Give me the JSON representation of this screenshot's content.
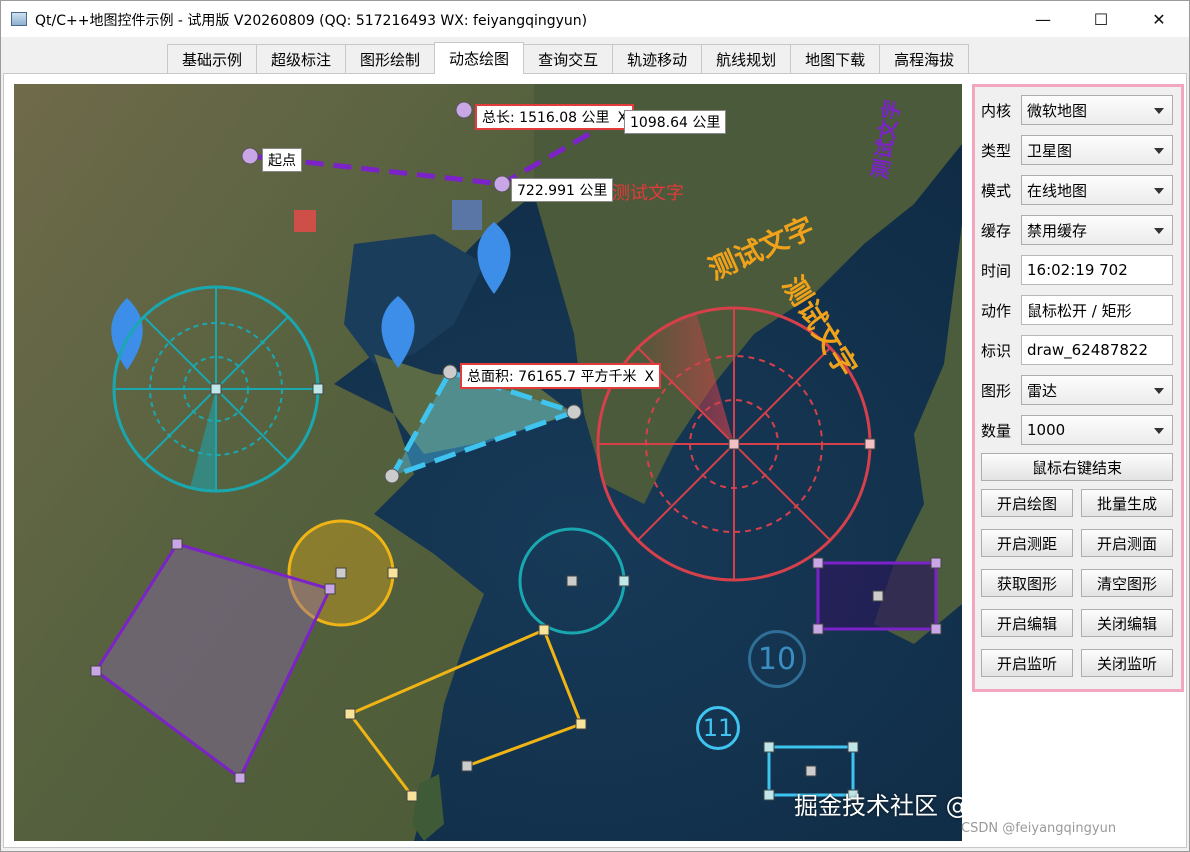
{
  "window": {
    "title": "Qt/C++地图控件示例 - 试用版 V20260809 (QQ: 517216493 WX: feiyangqingyun)",
    "minimize": "—",
    "maximize": "☐",
    "close": "✕"
  },
  "tabs": [
    {
      "label": "基础示例",
      "active": false
    },
    {
      "label": "超级标注",
      "active": false
    },
    {
      "label": "图形绘制",
      "active": false
    },
    {
      "label": "动态绘图",
      "active": true
    },
    {
      "label": "查询交互",
      "active": false
    },
    {
      "label": "轨迹移动",
      "active": false
    },
    {
      "label": "航线规划",
      "active": false
    },
    {
      "label": "地图下载",
      "active": false
    },
    {
      "label": "高程海拔",
      "active": false
    }
  ],
  "map": {
    "labels": {
      "start": "起点",
      "total_length": "总长: 1516.08 公里",
      "total_length_close": "X",
      "dist_1": "1098.64 公里",
      "dist_2": "722.991 公里",
      "area": "总面积: 76165.7 平方千米",
      "area_close": "X"
    },
    "texts": {
      "test_text_1": "测试文字",
      "test_text_2": "测试文字",
      "test_text_3": "测试文字",
      "test_text_4": "测试文字"
    },
    "cluster_10": "10",
    "cluster_11": "11",
    "colors": {
      "purple": "#7b22c8",
      "teal": "#1aa8b0",
      "red": "#d6404a",
      "yellow": "#f0b514",
      "cyan": "#3fc4ef",
      "orange": "#f0a21a",
      "marker": "#3d8ee8"
    }
  },
  "panel": {
    "kernel": {
      "label": "内核",
      "value": "微软地图"
    },
    "type": {
      "label": "类型",
      "value": "卫星图"
    },
    "mode": {
      "label": "模式",
      "value": "在线地图"
    },
    "cache": {
      "label": "缓存",
      "value": "禁用缓存"
    },
    "time": {
      "label": "时间",
      "value": "16:02:19 702"
    },
    "action": {
      "label": "动作",
      "value": "鼠标松开 / 矩形"
    },
    "ident": {
      "label": "标识",
      "value": "draw_62487822"
    },
    "shape": {
      "label": "图形",
      "value": "雷达"
    },
    "count": {
      "label": "数量",
      "value": "1000"
    },
    "right_click_end": "鼠标右键结束",
    "buttons": {
      "start_draw": "开启绘图",
      "batch_gen": "批量生成",
      "start_measure_dist": "开启测距",
      "start_measure_area": "开启测面",
      "get_shapes": "获取图形",
      "clear_shapes": "清空图形",
      "start_edit": "开启编辑",
      "close_edit": "关闭编辑",
      "start_listen": "开启监听",
      "close_listen": "关闭监听"
    }
  },
  "watermark": {
    "main": "掘金技术社区 @ feiyangqingyun",
    "sub": "CSDN @feiyangqingyun"
  }
}
